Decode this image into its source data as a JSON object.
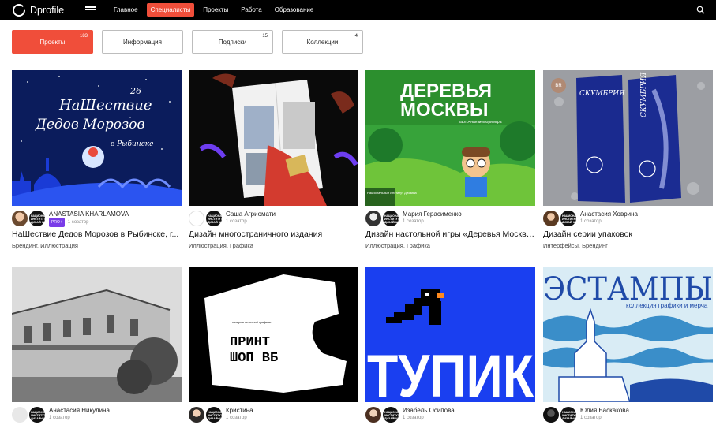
{
  "header": {
    "brand": "Dprofile",
    "nav": [
      "Главное",
      "Специалисты",
      "Проекты",
      "Работа",
      "Образование"
    ]
  },
  "tabs": [
    {
      "label": "Проекты",
      "count": "183"
    },
    {
      "label": "Информация",
      "count": ""
    },
    {
      "label": "Подписки",
      "count": "15"
    },
    {
      "label": "Коллекции",
      "count": "4"
    }
  ],
  "projects": [
    {
      "author": "ANASTASIA KHARLAMOVA",
      "badge": "PRO+",
      "rank": "1 созатор",
      "title": "НаШествие Дедов Морозов в Рыбинске, г...",
      "tags": "Брендинг, Иллюстрация"
    },
    {
      "author": "Саша Агриомати",
      "rank": "1 созатор",
      "title": "Дизайн многостраничного издания",
      "tags": "Иллюстрация, Графика"
    },
    {
      "author": "Мария Герасименко",
      "rank": "1 созатор",
      "title": "Дизайн настольной игры «Деревья Москвы»",
      "tags": "Иллюстрация, Графика"
    },
    {
      "author": "Анастасия Ховрина",
      "rank": "1 созатор",
      "title": "Дизайн серии упаковок",
      "tags": "Интерфейсы, Брендинг"
    },
    {
      "author": "Анастасия Никулина",
      "rank": "1 созатор"
    },
    {
      "author": "Кристина",
      "rank": "1 созатор"
    },
    {
      "author": "Изабель Осипова",
      "rank": "1 созатор"
    },
    {
      "author": "Юлия Баскакова",
      "rank": "1 созатор"
    }
  ],
  "art": {
    "p1_line1": "НаШествие",
    "p1_num": "26",
    "p1_line2": "Дедов Морозов",
    "p1_line3": "в Рыбинске",
    "p3_line1": "ДЕРЕВЬЯ",
    "p3_line2": "МОСКВЫ",
    "p3_sub": "карточная мемори игра",
    "p3_corner": "Национальный Институт Дизайна",
    "p4_badge": "BR",
    "p4_label": "СКУМБРИЯ",
    "p6_small": "галерея печатной графики",
    "p6_line1": "ПРИНТ",
    "p6_line2": "ШОП ВБ",
    "p7_word": "ТУПИК",
    "p8_word": "ЭСТАМПЫ",
    "p8_sub": "коллекция графики и мерча",
    "coauthor_logo": "НАЦИОНАЛЬНЫЙ ИНСТИТУТ ДИЗАЙНА"
  }
}
